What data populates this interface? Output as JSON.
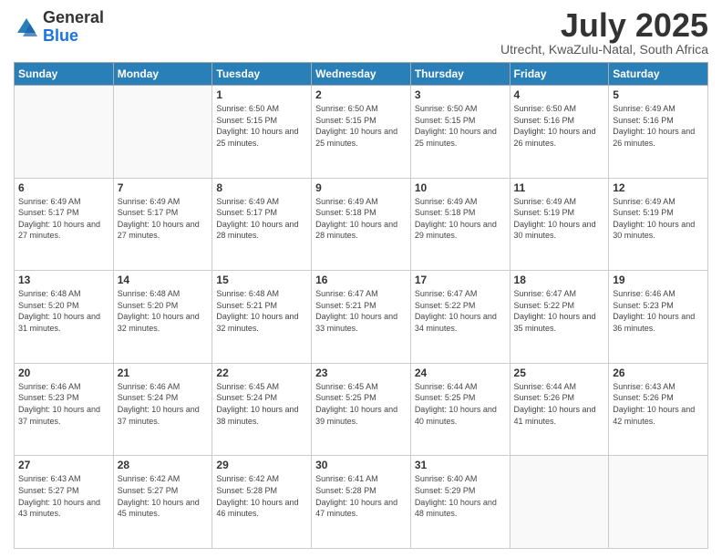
{
  "logo": {
    "general": "General",
    "blue": "Blue"
  },
  "title": {
    "month": "July 2025",
    "location": "Utrecht, KwaZulu-Natal, South Africa"
  },
  "weekdays": [
    "Sunday",
    "Monday",
    "Tuesday",
    "Wednesday",
    "Thursday",
    "Friday",
    "Saturday"
  ],
  "weeks": [
    [
      {
        "day": "",
        "sunrise": "",
        "sunset": "",
        "daylight": ""
      },
      {
        "day": "",
        "sunrise": "",
        "sunset": "",
        "daylight": ""
      },
      {
        "day": "1",
        "sunrise": "Sunrise: 6:50 AM",
        "sunset": "Sunset: 5:15 PM",
        "daylight": "Daylight: 10 hours and 25 minutes."
      },
      {
        "day": "2",
        "sunrise": "Sunrise: 6:50 AM",
        "sunset": "Sunset: 5:15 PM",
        "daylight": "Daylight: 10 hours and 25 minutes."
      },
      {
        "day": "3",
        "sunrise": "Sunrise: 6:50 AM",
        "sunset": "Sunset: 5:15 PM",
        "daylight": "Daylight: 10 hours and 25 minutes."
      },
      {
        "day": "4",
        "sunrise": "Sunrise: 6:50 AM",
        "sunset": "Sunset: 5:16 PM",
        "daylight": "Daylight: 10 hours and 26 minutes."
      },
      {
        "day": "5",
        "sunrise": "Sunrise: 6:49 AM",
        "sunset": "Sunset: 5:16 PM",
        "daylight": "Daylight: 10 hours and 26 minutes."
      }
    ],
    [
      {
        "day": "6",
        "sunrise": "Sunrise: 6:49 AM",
        "sunset": "Sunset: 5:17 PM",
        "daylight": "Daylight: 10 hours and 27 minutes."
      },
      {
        "day": "7",
        "sunrise": "Sunrise: 6:49 AM",
        "sunset": "Sunset: 5:17 PM",
        "daylight": "Daylight: 10 hours and 27 minutes."
      },
      {
        "day": "8",
        "sunrise": "Sunrise: 6:49 AM",
        "sunset": "Sunset: 5:17 PM",
        "daylight": "Daylight: 10 hours and 28 minutes."
      },
      {
        "day": "9",
        "sunrise": "Sunrise: 6:49 AM",
        "sunset": "Sunset: 5:18 PM",
        "daylight": "Daylight: 10 hours and 28 minutes."
      },
      {
        "day": "10",
        "sunrise": "Sunrise: 6:49 AM",
        "sunset": "Sunset: 5:18 PM",
        "daylight": "Daylight: 10 hours and 29 minutes."
      },
      {
        "day": "11",
        "sunrise": "Sunrise: 6:49 AM",
        "sunset": "Sunset: 5:19 PM",
        "daylight": "Daylight: 10 hours and 30 minutes."
      },
      {
        "day": "12",
        "sunrise": "Sunrise: 6:49 AM",
        "sunset": "Sunset: 5:19 PM",
        "daylight": "Daylight: 10 hours and 30 minutes."
      }
    ],
    [
      {
        "day": "13",
        "sunrise": "Sunrise: 6:48 AM",
        "sunset": "Sunset: 5:20 PM",
        "daylight": "Daylight: 10 hours and 31 minutes."
      },
      {
        "day": "14",
        "sunrise": "Sunrise: 6:48 AM",
        "sunset": "Sunset: 5:20 PM",
        "daylight": "Daylight: 10 hours and 32 minutes."
      },
      {
        "day": "15",
        "sunrise": "Sunrise: 6:48 AM",
        "sunset": "Sunset: 5:21 PM",
        "daylight": "Daylight: 10 hours and 32 minutes."
      },
      {
        "day": "16",
        "sunrise": "Sunrise: 6:47 AM",
        "sunset": "Sunset: 5:21 PM",
        "daylight": "Daylight: 10 hours and 33 minutes."
      },
      {
        "day": "17",
        "sunrise": "Sunrise: 6:47 AM",
        "sunset": "Sunset: 5:22 PM",
        "daylight": "Daylight: 10 hours and 34 minutes."
      },
      {
        "day": "18",
        "sunrise": "Sunrise: 6:47 AM",
        "sunset": "Sunset: 5:22 PM",
        "daylight": "Daylight: 10 hours and 35 minutes."
      },
      {
        "day": "19",
        "sunrise": "Sunrise: 6:46 AM",
        "sunset": "Sunset: 5:23 PM",
        "daylight": "Daylight: 10 hours and 36 minutes."
      }
    ],
    [
      {
        "day": "20",
        "sunrise": "Sunrise: 6:46 AM",
        "sunset": "Sunset: 5:23 PM",
        "daylight": "Daylight: 10 hours and 37 minutes."
      },
      {
        "day": "21",
        "sunrise": "Sunrise: 6:46 AM",
        "sunset": "Sunset: 5:24 PM",
        "daylight": "Daylight: 10 hours and 37 minutes."
      },
      {
        "day": "22",
        "sunrise": "Sunrise: 6:45 AM",
        "sunset": "Sunset: 5:24 PM",
        "daylight": "Daylight: 10 hours and 38 minutes."
      },
      {
        "day": "23",
        "sunrise": "Sunrise: 6:45 AM",
        "sunset": "Sunset: 5:25 PM",
        "daylight": "Daylight: 10 hours and 39 minutes."
      },
      {
        "day": "24",
        "sunrise": "Sunrise: 6:44 AM",
        "sunset": "Sunset: 5:25 PM",
        "daylight": "Daylight: 10 hours and 40 minutes."
      },
      {
        "day": "25",
        "sunrise": "Sunrise: 6:44 AM",
        "sunset": "Sunset: 5:26 PM",
        "daylight": "Daylight: 10 hours and 41 minutes."
      },
      {
        "day": "26",
        "sunrise": "Sunrise: 6:43 AM",
        "sunset": "Sunset: 5:26 PM",
        "daylight": "Daylight: 10 hours and 42 minutes."
      }
    ],
    [
      {
        "day": "27",
        "sunrise": "Sunrise: 6:43 AM",
        "sunset": "Sunset: 5:27 PM",
        "daylight": "Daylight: 10 hours and 43 minutes."
      },
      {
        "day": "28",
        "sunrise": "Sunrise: 6:42 AM",
        "sunset": "Sunset: 5:27 PM",
        "daylight": "Daylight: 10 hours and 45 minutes."
      },
      {
        "day": "29",
        "sunrise": "Sunrise: 6:42 AM",
        "sunset": "Sunset: 5:28 PM",
        "daylight": "Daylight: 10 hours and 46 minutes."
      },
      {
        "day": "30",
        "sunrise": "Sunrise: 6:41 AM",
        "sunset": "Sunset: 5:28 PM",
        "daylight": "Daylight: 10 hours and 47 minutes."
      },
      {
        "day": "31",
        "sunrise": "Sunrise: 6:40 AM",
        "sunset": "Sunset: 5:29 PM",
        "daylight": "Daylight: 10 hours and 48 minutes."
      },
      {
        "day": "",
        "sunrise": "",
        "sunset": "",
        "daylight": ""
      },
      {
        "day": "",
        "sunrise": "",
        "sunset": "",
        "daylight": ""
      }
    ]
  ]
}
